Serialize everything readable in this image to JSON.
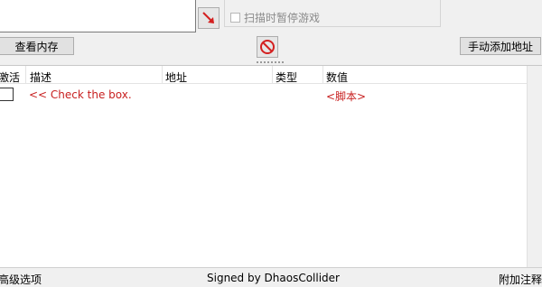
{
  "scan": {
    "pause_game_label": "扫描时暂停游戏"
  },
  "buttons": {
    "view_memory": "查看内存",
    "manual_add_address": "手动添加地址"
  },
  "icons": {
    "pointer": "red-arrow-icon",
    "stop": "no-entry-icon"
  },
  "table": {
    "headers": {
      "active": "激活",
      "description": "描述",
      "address": "地址",
      "type": "类型",
      "value": "数值"
    },
    "rows": [
      {
        "active": false,
        "description": "<< Check the box.",
        "address": "",
        "type": "",
        "value": "<脚本>"
      }
    ]
  },
  "status": {
    "left": "高级选项",
    "center": "Signed by DhaosCollider",
    "right": "附加注释"
  },
  "colors": {
    "script_text": "#c82020",
    "arrow": "#d42020"
  }
}
